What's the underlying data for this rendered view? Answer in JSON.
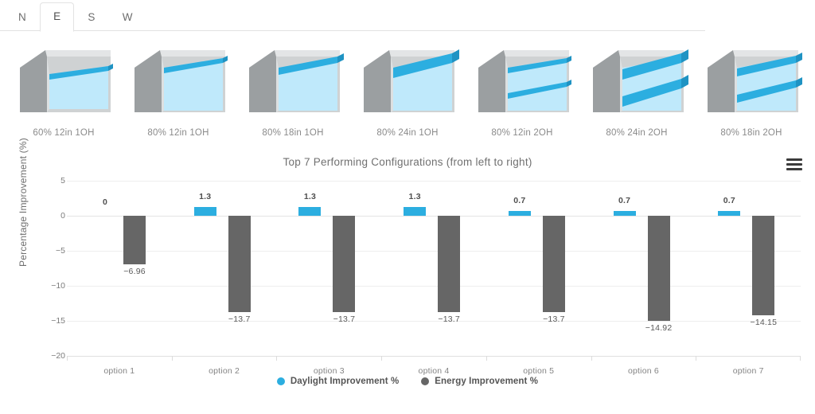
{
  "tabs": {
    "items": [
      {
        "label": "N",
        "active": false
      },
      {
        "label": "E",
        "active": true
      },
      {
        "label": "S",
        "active": false
      },
      {
        "label": "W",
        "active": false
      }
    ]
  },
  "configurations": [
    {
      "label": "60% 12in 1OH",
      "glass": "60",
      "overhangs": 1
    },
    {
      "label": "80% 12in 1OH",
      "glass": "80",
      "overhangs": 1
    },
    {
      "label": "80% 18in 1OH",
      "glass": "80",
      "overhangs": 1
    },
    {
      "label": "80% 24in 1OH",
      "glass": "80",
      "overhangs": 1
    },
    {
      "label": "80% 12in 2OH",
      "glass": "80",
      "overhangs": 2
    },
    {
      "label": "80% 24in 2OH",
      "glass": "80",
      "overhangs": 2
    },
    {
      "label": "80% 18in 2OH",
      "glass": "80",
      "overhangs": 2
    }
  ],
  "chart": {
    "title": "Top 7 Performing Configurations (from left to right)",
    "menu_icon": "hamburger-menu-icon"
  },
  "chart_data": {
    "type": "bar",
    "title": "Top 7 Performing Configurations (from left to right)",
    "xlabel": "",
    "ylabel": "Percentage Improvement (%)",
    "ylim": [
      -20,
      5
    ],
    "yticks": [
      5,
      0,
      -5,
      -10,
      -15,
      -20
    ],
    "ytick_labels": [
      "5",
      "0",
      "−5",
      "−10",
      "−15",
      "−20"
    ],
    "grid": true,
    "legend_position": "bottom",
    "categories": [
      "option 1",
      "option 2",
      "option 3",
      "option 4",
      "option 5",
      "option 6",
      "option 7"
    ],
    "series": [
      {
        "name": "Daylight Improvement %",
        "color": "#2CAEE0",
        "values": [
          0,
          1.3,
          1.3,
          1.3,
          0.7,
          0.7,
          0.7
        ],
        "labels": [
          "0",
          "1.3",
          "1.3",
          "1.3",
          "0.7",
          "0.7",
          "0.7"
        ]
      },
      {
        "name": "Energy Improvement %",
        "color": "#666666",
        "values": [
          -6.96,
          -13.7,
          -13.7,
          -13.7,
          -13.7,
          -14.92,
          -14.15
        ],
        "labels": [
          "−6.96",
          "−13.7",
          "−13.7",
          "−13.7",
          "−13.7",
          "−14.92",
          "−14.15"
        ]
      }
    ]
  },
  "legend": [
    {
      "label": "Daylight Improvement %",
      "color": "#2CAEE0"
    },
    {
      "label": "Energy Improvement %",
      "color": "#666666"
    }
  ]
}
